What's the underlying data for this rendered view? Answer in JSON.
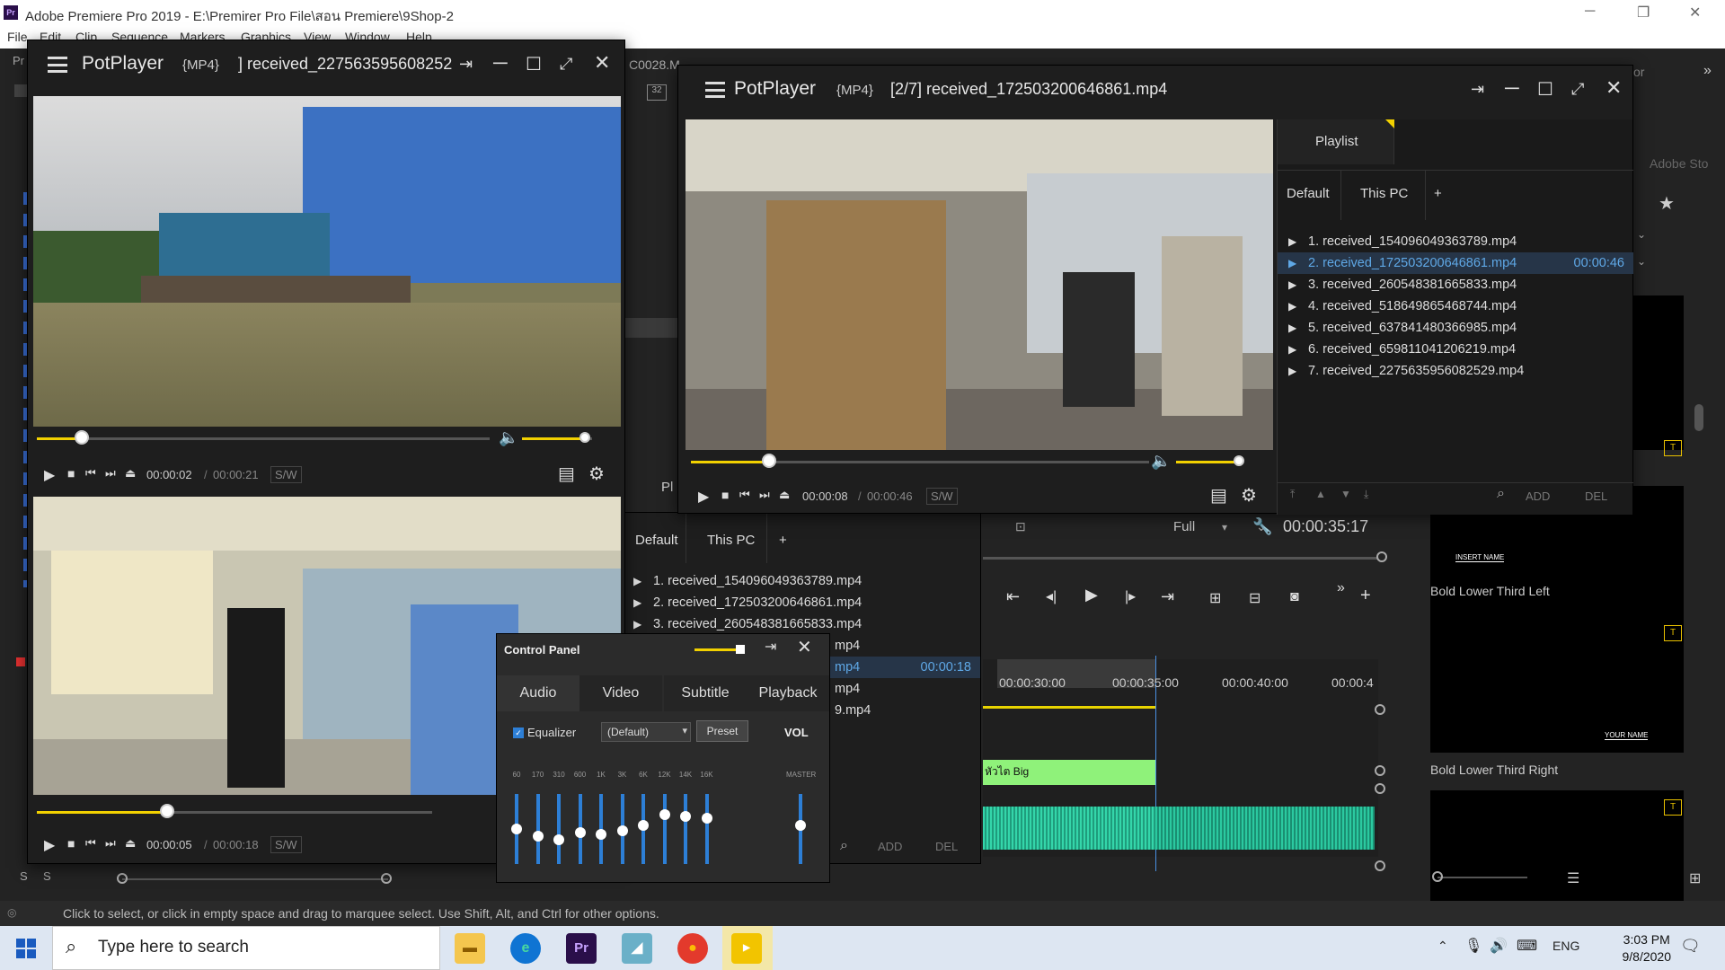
{
  "premiere": {
    "title": "Adobe Premiere Pro 2019 - E:\\Premirer Pro File\\สอน Premiere\\9Shop-2",
    "logo": "Pr",
    "menu": [
      "File",
      "Edit",
      "Clip",
      "Sequence",
      "Markers",
      "Graphics",
      "View",
      "Window",
      "Help"
    ],
    "status_text": "Click to select, or click in empty space and drag to marquee select. Use Shift, Alt, and Ctrl for other options.",
    "clip_label": "C0028.M",
    "panel_label_pl": "Pl",
    "right_panel_tab": "or",
    "adobe_stock_label": "Adobe Sto",
    "program": {
      "zoom": "Full",
      "timecode": "00:00:35:17"
    },
    "timeline": {
      "ruler": [
        "00:00:30:00",
        "00:00:35:00",
        "00:00:40:00",
        "00:00:4"
      ],
      "clip_name": "หัวไต Big",
      "track_labels": [
        "S",
        "S"
      ]
    },
    "essential_graphics": {
      "items": [
        {
          "label": "Bold Lower Third Left",
          "thumb_text": "INSERT NAME"
        },
        {
          "label": "Bold Lower Third Right",
          "thumb_text": "YOUR NAME"
        }
      ]
    }
  },
  "player1": {
    "brand": "PotPlayer",
    "format": "{MP4}",
    "file": "] received_227563595608252",
    "time_current": "00:00:02",
    "time_total": "00:00:21",
    "sw": "S/W",
    "progress": 0.1,
    "volume": 0.9
  },
  "player1b": {
    "time_current": "00:00:05",
    "time_total": "00:00:18",
    "sw": "S/W",
    "progress": 0.33
  },
  "player2": {
    "brand": "PotPlayer",
    "format": "{MP4}",
    "file": "[2/7] received_172503200646861.mp4",
    "time_current": "00:00:08",
    "time_total": "00:00:46",
    "sw": "S/W",
    "progress": 0.17,
    "volume": 0.9,
    "playlist": {
      "title": "Playlist",
      "tabs": [
        "Default",
        "This PC",
        "+"
      ],
      "items": [
        {
          "label": "1. received_154096049363789.mp4",
          "dur": ""
        },
        {
          "label": "2. received_172503200646861.mp4",
          "dur": "00:00:46"
        },
        {
          "label": "3. received_260548381665833.mp4",
          "dur": ""
        },
        {
          "label": "4. received_518649865468744.mp4",
          "dur": ""
        },
        {
          "label": "5. received_637841480366985.mp4",
          "dur": ""
        },
        {
          "label": "6. received_659811041206219.mp4",
          "dur": ""
        },
        {
          "label": "7. received_2275635956082529.mp4",
          "dur": ""
        }
      ],
      "add": "ADD",
      "del": "DEL"
    }
  },
  "playlist_back": {
    "tabs": [
      "Default",
      "This PC",
      "+"
    ],
    "items": [
      {
        "label": "1. received_154096049363789.mp4",
        "dur": ""
      },
      {
        "label": "2. received_172503200646861.mp4",
        "dur": ""
      },
      {
        "label": "3. received_260548381665833.mp4",
        "dur": ""
      },
      {
        "label": "mp4",
        "dur": ""
      },
      {
        "label": "mp4",
        "dur": "00:00:18"
      },
      {
        "label": "mp4",
        "dur": ""
      },
      {
        "label": "9.mp4",
        "dur": ""
      }
    ],
    "add": "ADD",
    "del": "DEL"
  },
  "control_panel": {
    "title": "Control Panel",
    "tabs": [
      "Audio",
      "Video",
      "Subtitle",
      "Playback"
    ],
    "equalizer_label": "Equalizer",
    "preset_select": "(Default)",
    "preset_button": "Preset",
    "vol_label": "VOL",
    "master_label": "MASTER",
    "bands": [
      "60",
      "170",
      "310",
      "600",
      "1K",
      "3K",
      "6K",
      "12K",
      "14K",
      "16K"
    ],
    "band_levels": [
      0.5,
      0.4,
      0.35,
      0.45,
      0.42,
      0.48,
      0.55,
      0.7,
      0.68,
      0.66
    ],
    "master_level": 0.55
  },
  "taskbar": {
    "search_placeholder": "Type here to search",
    "lang": "ENG",
    "time": "3:03 PM",
    "date": "9/8/2020"
  }
}
